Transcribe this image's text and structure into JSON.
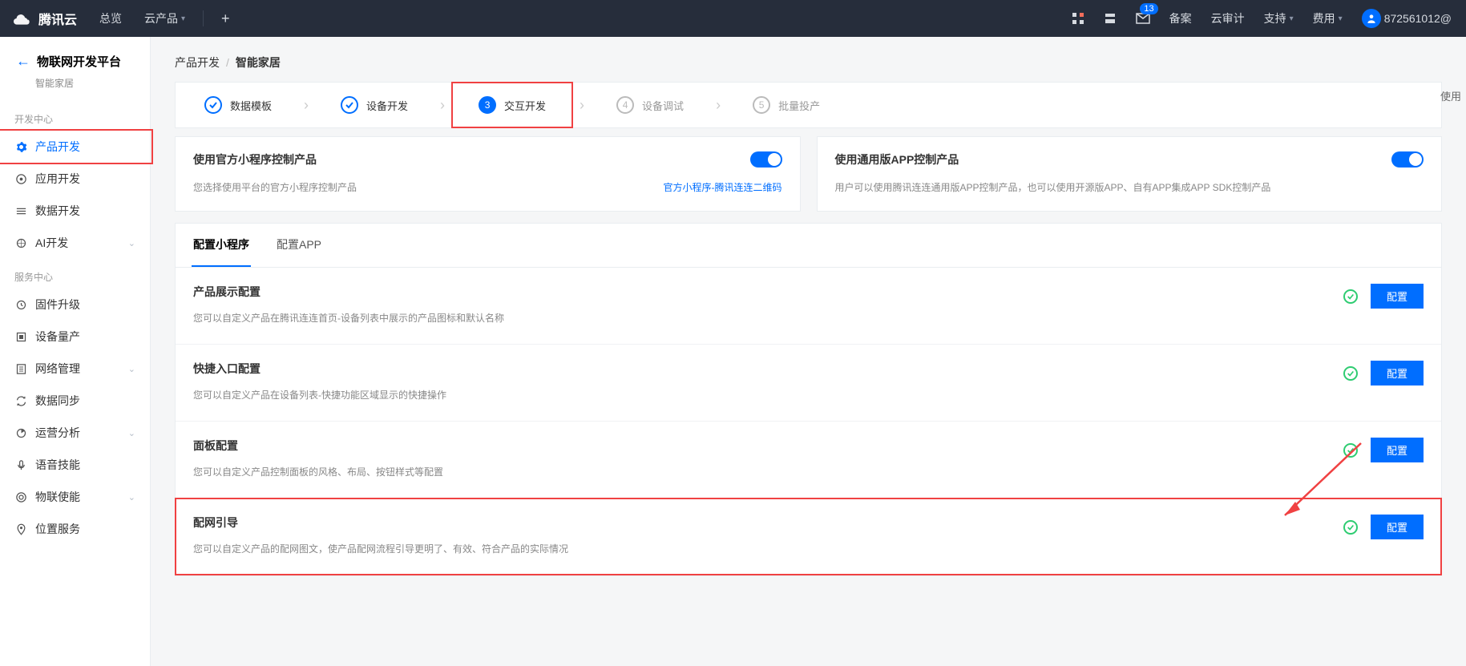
{
  "header": {
    "brand": "腾讯云",
    "nav": {
      "overview": "总览",
      "products": "云产品"
    },
    "right": {
      "beian": "备案",
      "audit": "云审计",
      "support": "支持",
      "fee": "费用",
      "msg_count": "13",
      "user": "872561012@"
    }
  },
  "sidebar": {
    "back_title": "物联网开发平台",
    "back_sub": "智能家居",
    "group_dev": "开发中心",
    "items_dev": [
      {
        "label": "产品开发"
      },
      {
        "label": "应用开发"
      },
      {
        "label": "数据开发"
      },
      {
        "label": "AI开发"
      }
    ],
    "group_srv": "服务中心",
    "items_srv": [
      {
        "label": "固件升级"
      },
      {
        "label": "设备量产"
      },
      {
        "label": "网络管理"
      },
      {
        "label": "数据同步"
      },
      {
        "label": "运营分析"
      },
      {
        "label": "语音技能"
      },
      {
        "label": "物联使能"
      },
      {
        "label": "位置服务"
      }
    ]
  },
  "breadcrumb": {
    "a": "产品开发",
    "b": "智能家居"
  },
  "steps": [
    {
      "label": "数据模板"
    },
    {
      "label": "设备开发"
    },
    {
      "num": "3",
      "label": "交互开发"
    },
    {
      "num": "4",
      "label": "设备调试"
    },
    {
      "num": "5",
      "label": "批量投产"
    }
  ],
  "ctrl": {
    "left": {
      "title": "使用官方小程序控制产品",
      "desc": "您选择使用平台的官方小程序控制产品",
      "link": "官方小程序-腾讯连连二维码"
    },
    "right": {
      "title": "使用通用版APP控制产品",
      "desc": "用户可以使用腾讯连连通用版APP控制产品，也可以使用开源版APP、自有APP集成APP SDK控制产品"
    }
  },
  "tabs": {
    "a": "配置小程序",
    "b": "配置APP"
  },
  "sections": [
    {
      "title": "产品展示配置",
      "desc": "您可以自定义产品在腾讯连连首页-设备列表中展示的产品图标和默认名称"
    },
    {
      "title": "快捷入口配置",
      "desc": "您可以自定义产品在设备列表-快捷功能区域显示的快捷操作"
    },
    {
      "title": "面板配置",
      "desc": "您可以自定义产品控制面板的风格、布局、按钮样式等配置"
    },
    {
      "title": "配网引导",
      "desc": "您可以自定义产品的配网图文，使产品配网流程引导更明了、有效、符合产品的实际情况"
    }
  ],
  "btn_label": "配置",
  "use_label": "使用"
}
